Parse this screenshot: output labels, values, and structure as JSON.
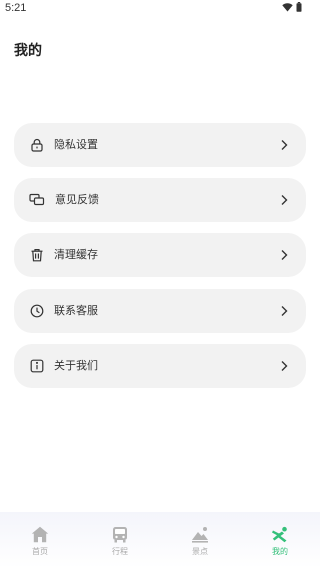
{
  "status": {
    "time": "5:21"
  },
  "page": {
    "title": "我的"
  },
  "menu": [
    {
      "label": "隐私设置",
      "icon": "lock-icon"
    },
    {
      "label": "意见反馈",
      "icon": "chat-icon"
    },
    {
      "label": "清理缓存",
      "icon": "trash-icon"
    },
    {
      "label": "联系客服",
      "icon": "clock-icon"
    },
    {
      "label": "关于我们",
      "icon": "info-icon"
    }
  ],
  "nav": [
    {
      "label": "首页",
      "icon": "home-icon"
    },
    {
      "label": "行程",
      "icon": "bus-icon"
    },
    {
      "label": "景点",
      "icon": "mountain-icon"
    },
    {
      "label": "我的",
      "icon": "profile-icon",
      "active": true
    }
  ],
  "colors": {
    "accent": "#34c07a",
    "card": "#f2f2f2",
    "nav_inactive": "#a9a9a9"
  }
}
